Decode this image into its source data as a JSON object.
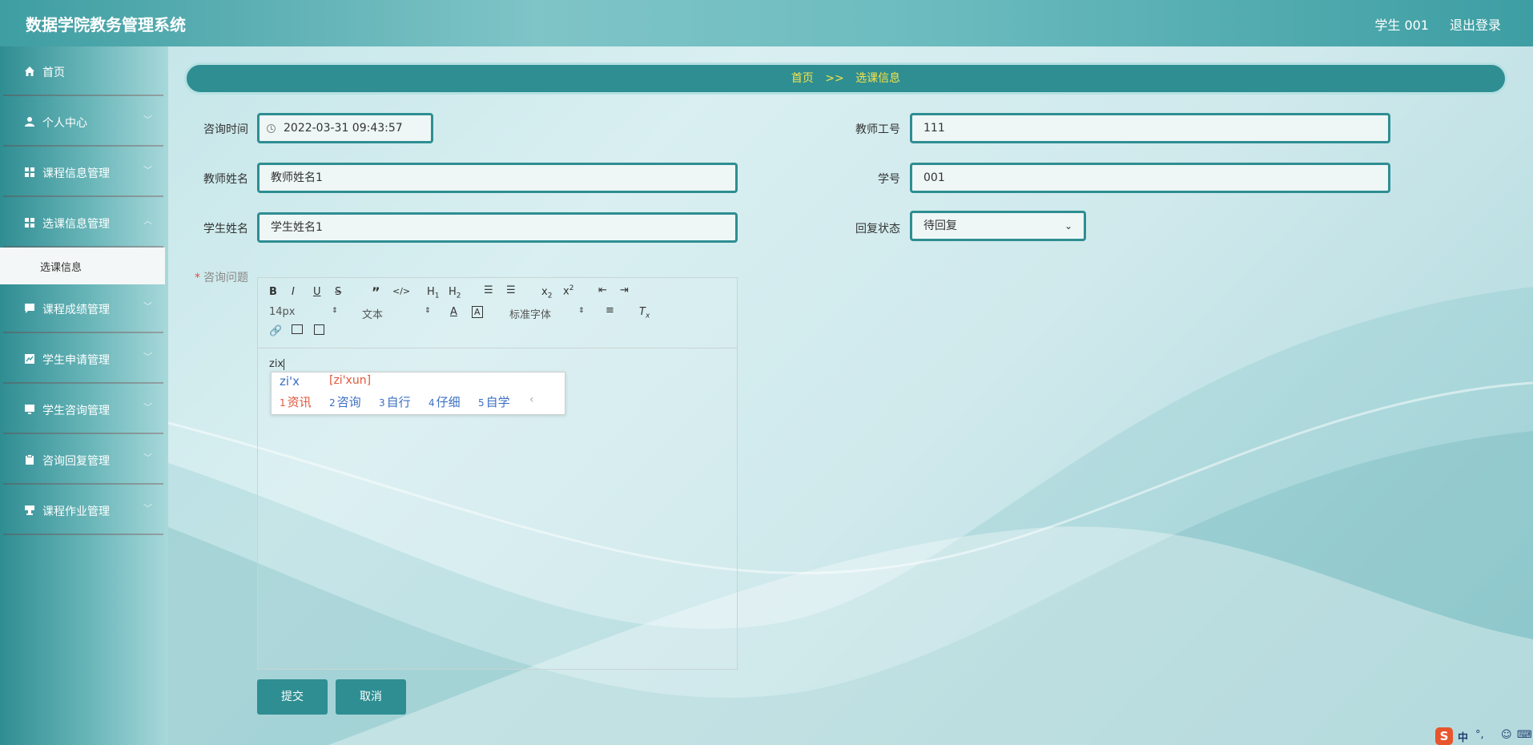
{
  "app": {
    "title": "数据学院教务管理系统"
  },
  "header": {
    "user": "学生 001",
    "logout": "退出登录"
  },
  "sidebar": {
    "items": [
      {
        "label": "首页",
        "icon": "home-icon"
      },
      {
        "label": "个人中心",
        "icon": "user-icon"
      },
      {
        "label": "课程信息管理",
        "icon": "grid-icon"
      },
      {
        "label": "选课信息管理",
        "icon": "grid-icon"
      },
      {
        "label": "课程成绩管理",
        "icon": "chat-icon"
      },
      {
        "label": "学生申请管理",
        "icon": "chart-icon"
      },
      {
        "label": "学生咨询管理",
        "icon": "monitor-icon"
      },
      {
        "label": "咨询回复管理",
        "icon": "clipboard-icon"
      },
      {
        "label": "课程作业管理",
        "icon": "stamp-icon"
      }
    ],
    "sub_active": "选课信息"
  },
  "breadcrumb": {
    "home": "首页",
    "sep": ">>",
    "current": "选课信息"
  },
  "form": {
    "consult_time_label": "咨询时间",
    "consult_time_value": "2022-03-31 09:43:57",
    "teacher_id_label": "教师工号",
    "teacher_id_value": "111",
    "teacher_name_label": "教师姓名",
    "teacher_name_value": "教师姓名1",
    "student_no_label": "学号",
    "student_no_value": "001",
    "student_name_label": "学生姓名",
    "student_name_value": "学生姓名1",
    "reply_status_label": "回复状态",
    "reply_status_value": "待回复",
    "question_label": "咨询问题",
    "submit": "提交",
    "cancel": "取消"
  },
  "editor": {
    "font_size": "14px",
    "block_type": "文本",
    "font_family": "标准字体",
    "content": "zix"
  },
  "ime": {
    "pinyin": "zi'x",
    "hint": "[zi'xun]",
    "candidates": [
      {
        "n": "1",
        "word": "资讯"
      },
      {
        "n": "2",
        "word": "咨询"
      },
      {
        "n": "3",
        "word": "自行"
      },
      {
        "n": "4",
        "word": "仔细"
      },
      {
        "n": "5",
        "word": "自学"
      }
    ]
  },
  "tray": {
    "logo": "S",
    "lang": "中",
    "punct": "°,",
    "face": "☺",
    "kb": "⌨"
  },
  "colors": {
    "primary": "#2e8e92",
    "breadcrumb_text": "#f6e34a",
    "required": "#e94a4a"
  }
}
